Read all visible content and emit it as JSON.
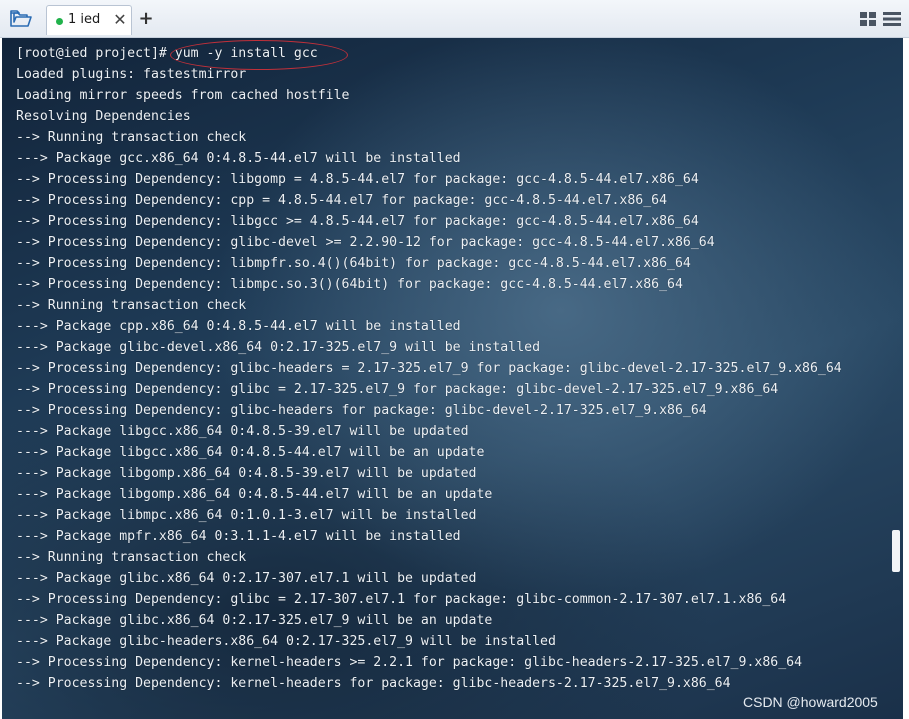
{
  "tab": {
    "label": "1 ied",
    "close": "✕"
  },
  "add_tab": "+",
  "terminal": {
    "lines": [
      "[root@ied project]# yum -y install gcc",
      "Loaded plugins: fastestmirror",
      "Loading mirror speeds from cached hostfile",
      "Resolving Dependencies",
      "--> Running transaction check",
      "---> Package gcc.x86_64 0:4.8.5-44.el7 will be installed",
      "--> Processing Dependency: libgomp = 4.8.5-44.el7 for package: gcc-4.8.5-44.el7.x86_64",
      "--> Processing Dependency: cpp = 4.8.5-44.el7 for package: gcc-4.8.5-44.el7.x86_64",
      "--> Processing Dependency: libgcc >= 4.8.5-44.el7 for package: gcc-4.8.5-44.el7.x86_64",
      "--> Processing Dependency: glibc-devel >= 2.2.90-12 for package: gcc-4.8.5-44.el7.x86_64",
      "--> Processing Dependency: libmpfr.so.4()(64bit) for package: gcc-4.8.5-44.el7.x86_64",
      "--> Processing Dependency: libmpc.so.3()(64bit) for package: gcc-4.8.5-44.el7.x86_64",
      "--> Running transaction check",
      "---> Package cpp.x86_64 0:4.8.5-44.el7 will be installed",
      "---> Package glibc-devel.x86_64 0:2.17-325.el7_9 will be installed",
      "--> Processing Dependency: glibc-headers = 2.17-325.el7_9 for package: glibc-devel-2.17-325.el7_9.x86_64",
      "--> Processing Dependency: glibc = 2.17-325.el7_9 for package: glibc-devel-2.17-325.el7_9.x86_64",
      "--> Processing Dependency: glibc-headers for package: glibc-devel-2.17-325.el7_9.x86_64",
      "---> Package libgcc.x86_64 0:4.8.5-39.el7 will be updated",
      "---> Package libgcc.x86_64 0:4.8.5-44.el7 will be an update",
      "---> Package libgomp.x86_64 0:4.8.5-39.el7 will be updated",
      "---> Package libgomp.x86_64 0:4.8.5-44.el7 will be an update",
      "---> Package libmpc.x86_64 0:1.0.1-3.el7 will be installed",
      "---> Package mpfr.x86_64 0:3.1.1-4.el7 will be installed",
      "--> Running transaction check",
      "---> Package glibc.x86_64 0:2.17-307.el7.1 will be updated",
      "--> Processing Dependency: glibc = 2.17-307.el7.1 for package: glibc-common-2.17-307.el7.1.x86_64",
      "---> Package glibc.x86_64 0:2.17-325.el7_9 will be an update",
      "---> Package glibc-headers.x86_64 0:2.17-325.el7_9 will be installed",
      "--> Processing Dependency: kernel-headers >= 2.2.1 for package: glibc-headers-2.17-325.el7_9.x86_64",
      "--> Processing Dependency: kernel-headers for package: glibc-headers-2.17-325.el7_9.x86_64"
    ]
  },
  "watermark": "CSDN @howard2005",
  "icons": {
    "open": "folder-open-icon",
    "status": "connection-status-icon",
    "close": "close-icon",
    "add": "plus-icon",
    "grid": "grid-view-icon",
    "list": "list-view-icon"
  },
  "colors": {
    "status_dot": "#21b24b",
    "highlight_ellipse": "#c0303a",
    "terminal_text": "#ecf1f6"
  }
}
